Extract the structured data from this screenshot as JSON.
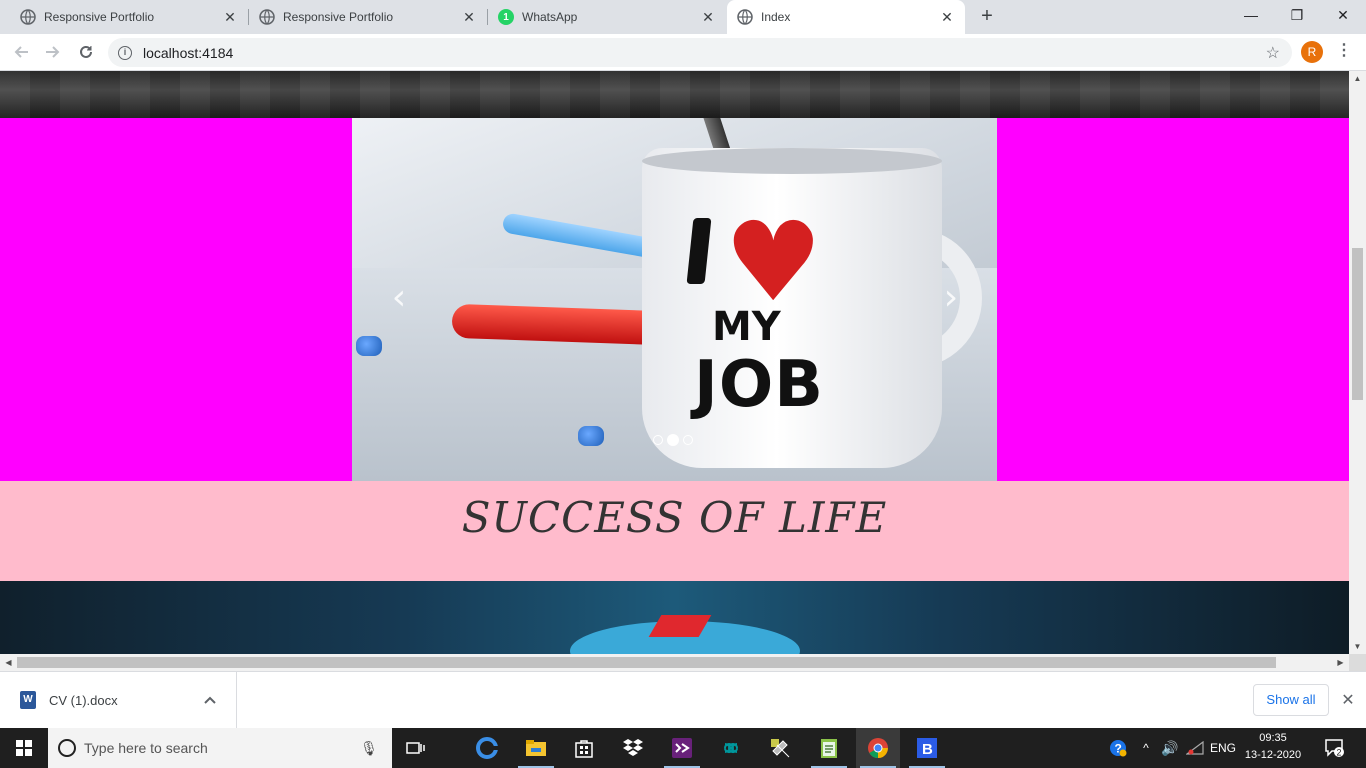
{
  "browser": {
    "tabs": [
      {
        "title": "Responsive Portfolio",
        "icon": "globe-icon",
        "active": false
      },
      {
        "title": "Responsive Portfolio",
        "icon": "globe-icon",
        "active": false
      },
      {
        "title": "WhatsApp",
        "icon": "whatsapp-icon",
        "badge": "1",
        "active": false
      },
      {
        "title": "Index",
        "icon": "globe-icon",
        "active": true
      }
    ],
    "new_tab": "+",
    "window_controls": {
      "minimize": "—",
      "restore": "❐",
      "close": "✕"
    },
    "url": "localhost:4184",
    "profile_initial": "R",
    "colors": {
      "accent": "#1a73e8",
      "tabstrip": "#dee1e6",
      "profile": "#e8710a"
    }
  },
  "page": {
    "caption_title": "SUCCESS OF LIFE",
    "colors": {
      "side_bg": "#ff00ff",
      "caption_bg": "#ffbbcc"
    },
    "carousel": {
      "prev_label": "‹",
      "next_label": "›",
      "indicators": [
        false,
        true,
        false
      ],
      "mug_text_top": "I",
      "mug_text_mid": "MY",
      "mug_text_bottom": "JOB"
    }
  },
  "download_bar": {
    "file_name": "CV (1).docx",
    "file_icon": "word-doc-icon",
    "show_all": "Show all"
  },
  "taskbar": {
    "search_placeholder": "Type here to search",
    "language": "ENG",
    "time": "09:35",
    "date": "13-12-2020",
    "notification_count": "2",
    "apps": [
      "task-view-icon",
      "edge-icon",
      "file-explorer-icon",
      "store-icon",
      "dropbox-icon",
      "visual-studio-icon",
      "arduino-icon",
      "tool-icon",
      "notepad-icon",
      "chrome-icon",
      "blue-app-icon"
    ]
  }
}
